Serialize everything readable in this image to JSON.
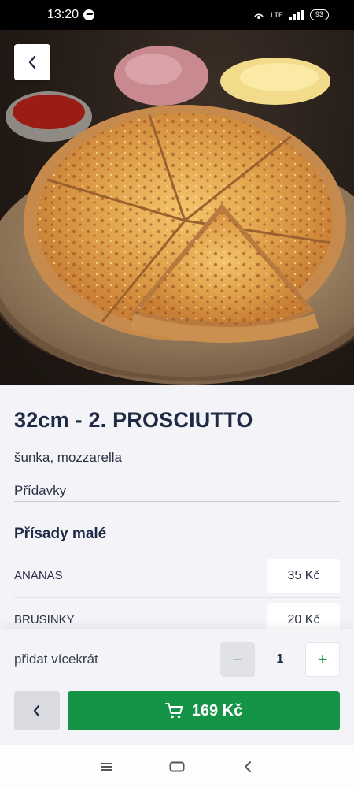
{
  "status_bar": {
    "time": "13:20",
    "network": "LTE",
    "battery": "93"
  },
  "product": {
    "title": "32cm - 2. PROSCIUTTO",
    "ingredients": "šunka, mozzarella",
    "addons_label": "Přídavky"
  },
  "extras_section": {
    "title": "Přísady malé",
    "items": [
      {
        "name": "ANANAS",
        "price": "35 Kč"
      },
      {
        "name": "BRUSINKY",
        "price": "20 Kč"
      }
    ]
  },
  "order": {
    "multi_label": "přidat vícekrát",
    "quantity": "1",
    "minus": "−",
    "plus": "+",
    "total": "169 Kč"
  },
  "colors": {
    "accent": "#159447",
    "title": "#1f2a44",
    "background": "#f3f3f8"
  },
  "icons": {
    "back": "chevron-left-icon",
    "cart": "cart-icon",
    "nav_recents": "menu-icon",
    "nav_home": "home-icon",
    "nav_back": "chevron-left-icon"
  }
}
